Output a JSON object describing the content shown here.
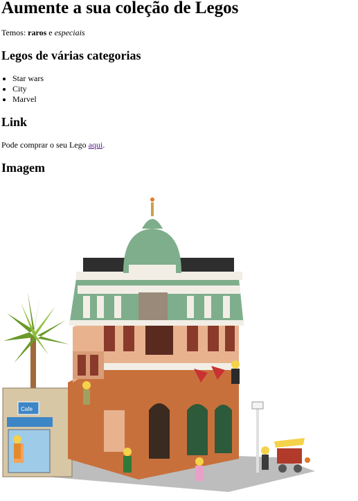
{
  "title": "Aumente a sua coleção de Legos",
  "intro": {
    "prefix": "Temos: ",
    "bold": "raros",
    "middle": " e ",
    "italic": "especiais"
  },
  "categories": {
    "heading": "Legos de várias categorias",
    "items": [
      "Star wars",
      "City",
      "Marvel"
    ]
  },
  "link_section": {
    "heading": "Link",
    "prefix": "Pode comprar o seu Lego ",
    "link_text": "aqui",
    "suffix": "."
  },
  "image_section": {
    "heading": "Imagem"
  },
  "image": {
    "subject": "LEGO Boutique Hotel modular building",
    "sign_text": "Cafe",
    "colors": {
      "dome": "#7fae8c",
      "facade": "#e8b28f",
      "ground": "#c8703c",
      "trim": "#f2eee6",
      "palm": "#6a9a2a"
    }
  }
}
